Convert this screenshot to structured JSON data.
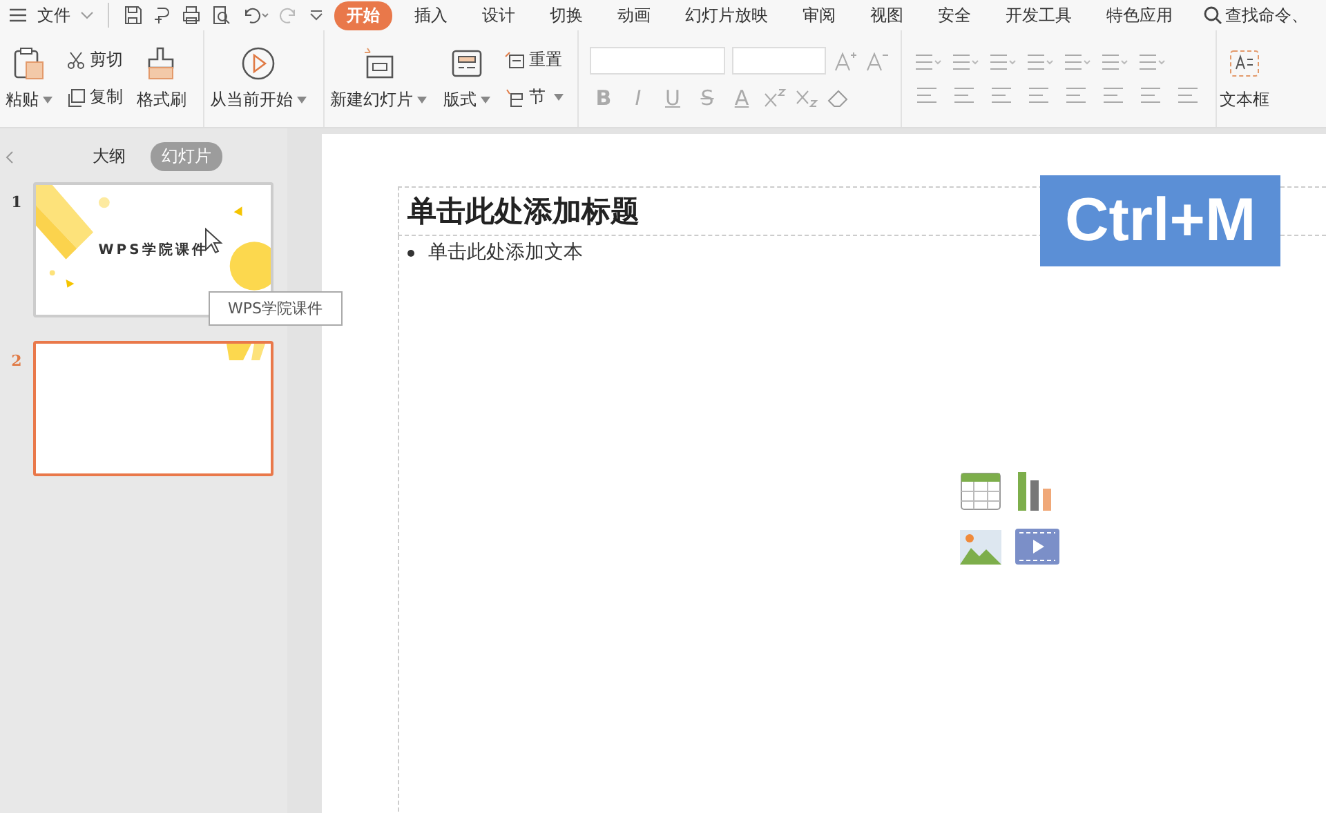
{
  "menu": {
    "file_label": "文件",
    "tabs": [
      {
        "label": "开始",
        "selected": true
      },
      {
        "label": "插入",
        "selected": false
      },
      {
        "label": "设计",
        "selected": false
      },
      {
        "label": "切换",
        "selected": false
      },
      {
        "label": "动画",
        "selected": false
      },
      {
        "label": "幻灯片放映",
        "selected": false
      },
      {
        "label": "审阅",
        "selected": false
      },
      {
        "label": "视图",
        "selected": false
      },
      {
        "label": "安全",
        "selected": false
      },
      {
        "label": "开发工具",
        "selected": false
      },
      {
        "label": "特色应用",
        "selected": false
      }
    ],
    "search": "查找命令、"
  },
  "ribbon": {
    "paste": "粘贴",
    "cut": "剪切",
    "copy": "复制",
    "format_painter": "格式刷",
    "from_current": "从当前开始",
    "new_slide": "新建幻灯片",
    "layout": "版式",
    "reset": "重置",
    "section": "节",
    "format_buttons": [
      "B",
      "I",
      "U",
      "S",
      "A"
    ],
    "text_box": "文本框"
  },
  "sidebar": {
    "view_tabs": [
      {
        "label": "大纲",
        "selected": false
      },
      {
        "label": "幻灯片",
        "selected": true
      }
    ],
    "thumbnails": [
      {
        "number": "1",
        "title": "WPS学院课件",
        "selected": false
      },
      {
        "number": "2",
        "selected": true
      }
    ],
    "tooltip": "WPS学院课件"
  },
  "slide": {
    "title_placeholder": "单击此处添加标题",
    "body_placeholder": "单击此处添加文本",
    "shortcut": "Ctrl+M"
  }
}
